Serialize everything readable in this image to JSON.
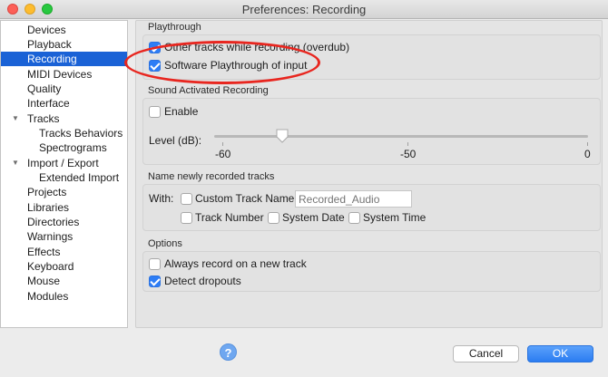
{
  "window": {
    "title": "Preferences: Recording"
  },
  "sidebar": {
    "items": [
      {
        "label": "Devices"
      },
      {
        "label": "Playback"
      },
      {
        "label": "Recording"
      },
      {
        "label": "MIDI Devices"
      },
      {
        "label": "Quality"
      },
      {
        "label": "Interface"
      },
      {
        "label": "Tracks"
      },
      {
        "label": "Tracks Behaviors"
      },
      {
        "label": "Spectrograms"
      },
      {
        "label": "Import / Export"
      },
      {
        "label": "Extended Import"
      },
      {
        "label": "Projects"
      },
      {
        "label": "Libraries"
      },
      {
        "label": "Directories"
      },
      {
        "label": "Warnings"
      },
      {
        "label": "Effects"
      },
      {
        "label": "Keyboard"
      },
      {
        "label": "Mouse"
      },
      {
        "label": "Modules"
      }
    ],
    "selected": "Recording"
  },
  "playthrough": {
    "title": "Playthrough",
    "overdub_label": "Other tracks while recording (overdub)",
    "overdub_checked": true,
    "software_label": "Software Playthrough of input",
    "software_checked": true
  },
  "sound_activated": {
    "title": "Sound Activated Recording",
    "enable_label": "Enable",
    "enable_checked": false,
    "level_label": "Level (dB):",
    "level_value_db": -50,
    "slider_min": -60,
    "slider_max": 0,
    "tick_labels": [
      "-60",
      "-50",
      "0"
    ]
  },
  "naming": {
    "title": "Name newly recorded tracks",
    "with_label": "With:",
    "custom_label": "Custom Track Name",
    "custom_checked": false,
    "custom_value": "",
    "custom_placeholder": "Recorded_Audio",
    "track_number_label": "Track Number",
    "system_date_label": "System Date",
    "system_time_label": "System Time"
  },
  "options": {
    "title": "Options",
    "always_new_label": "Always record on a new track",
    "always_new_checked": false,
    "detect_dropouts_label": "Detect dropouts",
    "detect_dropouts_checked": true
  },
  "footer": {
    "help_label": "?",
    "cancel_label": "Cancel",
    "ok_label": "OK"
  },
  "colors": {
    "selection": "#1a62d6",
    "accent": "#2d7df6",
    "highlight_oval": "#e8261f"
  },
  "icons": [
    "close-button",
    "minimize-button",
    "maximize-button",
    "disclosure-triangle-icon",
    "help-icon"
  ]
}
